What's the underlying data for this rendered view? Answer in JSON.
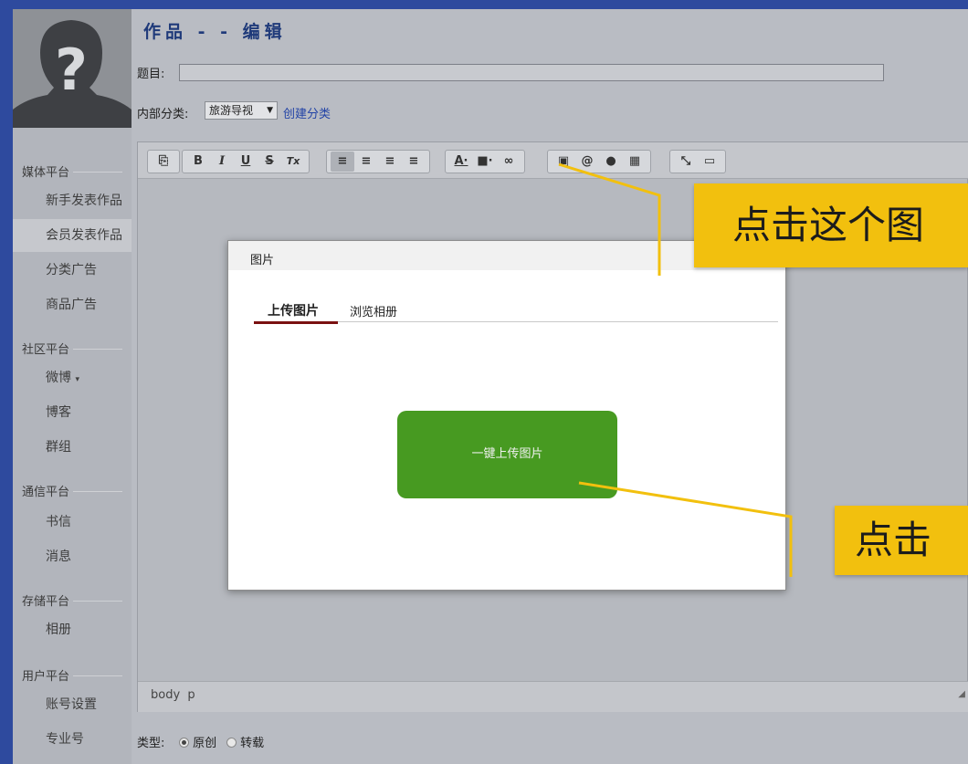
{
  "sidebar": {
    "categories": [
      {
        "label": "媒体平台",
        "items": [
          "新手发表作品",
          "会员发表作品",
          "分类广告",
          "商品广告"
        ]
      },
      {
        "label": "社区平台",
        "items": [
          "微博",
          "博客",
          "群组"
        ]
      },
      {
        "label": "通信平台",
        "items": [
          "书信",
          "消息"
        ]
      },
      {
        "label": "存储平台",
        "items": [
          "相册"
        ]
      },
      {
        "label": "用户平台",
        "items": [
          "账号设置",
          "专业号"
        ]
      }
    ],
    "active_item": "会员发表作品"
  },
  "header": {
    "title": "作品 - - 编辑"
  },
  "form": {
    "title_label": "题目:",
    "title_value": "",
    "category_label": "内部分类:",
    "category_selected": "旅游导视",
    "create_category": "创建分类",
    "type_label": "类型:",
    "type_options": [
      "原创",
      "转载"
    ],
    "type_selected": "原创"
  },
  "toolbar": {
    "groups": [
      [
        {
          "icon": "source-icon",
          "glyph": "⎘"
        }
      ],
      [
        {
          "icon": "bold-icon",
          "glyph": "B"
        },
        {
          "icon": "italic-icon",
          "glyph": "I"
        },
        {
          "icon": "underline-icon",
          "glyph": "U"
        },
        {
          "icon": "strike-icon",
          "glyph": "S"
        },
        {
          "icon": "remove-format-icon",
          "glyph": "Tx"
        }
      ],
      [
        {
          "icon": "align-left-icon",
          "glyph": "≡",
          "active": true
        },
        {
          "icon": "align-center-icon",
          "glyph": "≡"
        },
        {
          "icon": "align-right-icon",
          "glyph": "≡"
        },
        {
          "icon": "justify-icon",
          "glyph": "≡"
        }
      ],
      [
        {
          "icon": "text-color-icon",
          "glyph": "A·"
        },
        {
          "icon": "bg-color-icon",
          "glyph": "■·"
        },
        {
          "icon": "link-icon",
          "glyph": "∞"
        }
      ],
      [
        {
          "icon": "image-icon",
          "glyph": "▣"
        },
        {
          "icon": "attachment-icon",
          "glyph": "@"
        },
        {
          "icon": "emoji-icon",
          "glyph": "●"
        },
        {
          "icon": "table-icon",
          "glyph": "▦"
        }
      ],
      [
        {
          "icon": "maximize-icon",
          "glyph": "⤡"
        },
        {
          "icon": "preview-icon",
          "glyph": "▭"
        }
      ]
    ]
  },
  "statusbar": {
    "path": "body  p"
  },
  "dialog": {
    "title": "图片",
    "tabs": [
      "上传图片",
      "浏览相册"
    ],
    "active_tab": "上传图片",
    "upload_button": "一键上传图片"
  },
  "callouts": {
    "image_tip": "点击这个图",
    "click_tip": "点击"
  },
  "colors": {
    "callout": "#f2c00e",
    "upload_button": "#479a21",
    "title": "#1f3a7a",
    "link": "#2243a6"
  }
}
